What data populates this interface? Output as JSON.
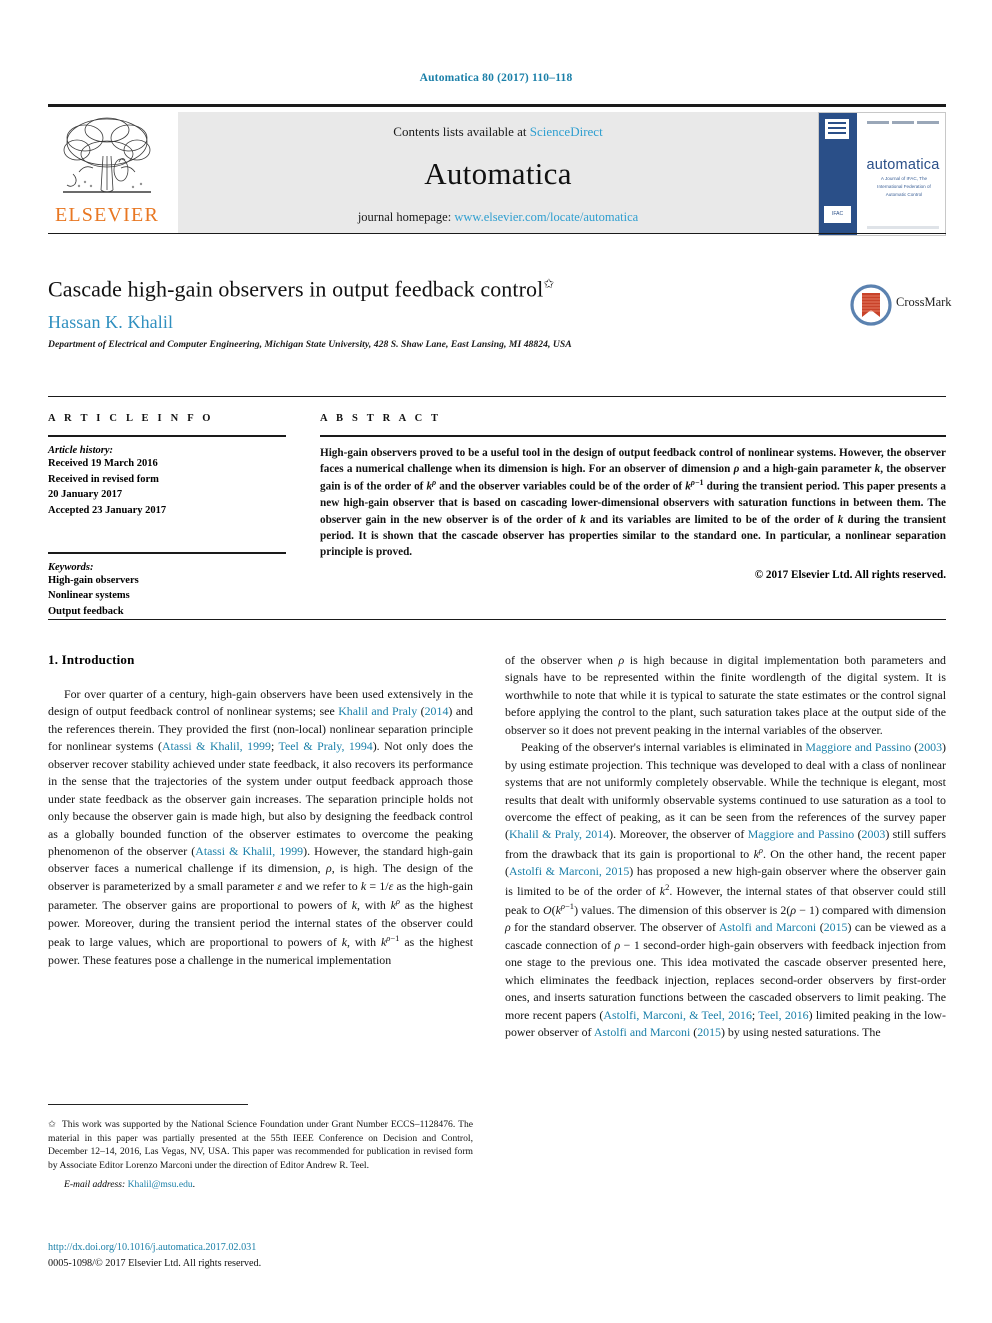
{
  "running_head": "Automatica 80 (2017) 110–118",
  "masthead": {
    "contents_prefix": "Contents lists available at ",
    "sciencedirect": "ScienceDirect",
    "journal_title": "Automatica",
    "homepage_prefix": "journal homepage: ",
    "homepage_url": "www.elsevier.com/locate/automatica",
    "publisher_logo_text": "ELSEVIER",
    "cover_title": "automatica",
    "cover_subtitle": "A Journal of IFAC, The International Federation of Automatic Control",
    "cover_ifac": "IFAC"
  },
  "article": {
    "title": "Cascade high-gain observers in output feedback control",
    "title_footnote_marker": "✩",
    "author": "Hassan K. Khalil",
    "affiliation": "Department of Electrical and Computer Engineering, Michigan State University, 428 S. Shaw Lane, East Lansing, MI 48824, USA",
    "crossmark_label": "CrossMark"
  },
  "info": {
    "heading": "A R T I C L E   I N F O",
    "history_label": "Article history:",
    "history": [
      "Received 19 March 2016",
      "Received in revised form",
      "20 January 2017",
      "Accepted 23 January 2017"
    ],
    "keywords_label": "Keywords:",
    "keywords": [
      "High-gain observers",
      "Nonlinear systems",
      "Output feedback"
    ]
  },
  "abstract": {
    "heading": "A B S T R A C T",
    "copyright": "© 2017 Elsevier Ltd. All rights reserved."
  },
  "body": {
    "section1_heading": "1. Introduction"
  },
  "footnote": {
    "marker": "✩",
    "email_label": "E-mail address:",
    "email": "Khalil@msu.edu",
    "doi": "http://dx.doi.org/10.1016/j.automatica.2017.02.031",
    "issn": "0005-1098/© 2017 Elsevier Ltd. All rights reserved."
  },
  "colors": {
    "link_blue": "#1a7fa8",
    "sciencedirect_blue": "#2f9fd0",
    "author_blue": "#2f8fbf",
    "elsevier_orange": "#E87722",
    "cover_blue": "#2a4f88"
  }
}
